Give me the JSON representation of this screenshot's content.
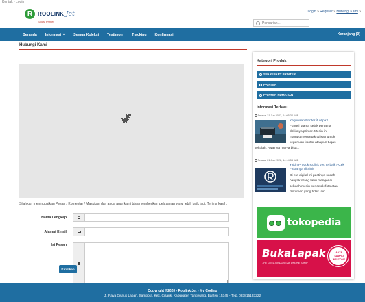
{
  "window": {
    "tab_title": "Kontak - Login"
  },
  "brand": {
    "logo_letter": "R",
    "name": "ROOLINK",
    "name_suffix": "Jet",
    "tagline": "Solusi Printer"
  },
  "top_links": {
    "login": "Login",
    "sep1": "»",
    "register": "Register",
    "sep2": "»",
    "contact": "Hubungi Kami",
    "sep3": "»"
  },
  "search": {
    "placeholder": "Pencarian..."
  },
  "nav": {
    "items": [
      {
        "label": "Beranda"
      },
      {
        "label": "Informasi"
      },
      {
        "label": "Semua Koleksi"
      },
      {
        "label": "Testimoni"
      },
      {
        "label": "Tracking"
      },
      {
        "label": "Konfirmasi"
      }
    ],
    "cart": "Keranjang (0)"
  },
  "main": {
    "title": "Hubungi Kami",
    "notice": "Silahkan meninggalkan Pesan / Komentar / Masukan dari anda agar kami bisa memberikan pelayanan yang lebih baik lagi. Terima kasih.",
    "form": {
      "name_label": "Nama Lengkap",
      "email_label": "Alamat Email",
      "message_label": "Isi Pesan",
      "submit": "Kirimkan"
    }
  },
  "sidebar": {
    "category_title": "Kategori Produk",
    "categories": [
      {
        "label": "SPAREPART PRINTER"
      },
      {
        "label": "PRINTER"
      },
      {
        "label": "PRINTER RUMAHAN"
      }
    ],
    "info_title": "Informasi Terbaru",
    "posts": [
      {
        "date": "Selasa, 21 Jun 2022, 14:05:32 WIB",
        "title": "Kegunaan Printer itu Apa?",
        "lines": [
          "Fungsi utama sejak pertama",
          "dirilisnya printer. Mesin ini",
          "mampu mencetak tulisan untuk",
          "keperluan kantor ataupun tugas"
        ],
        "tail": "sekolah. Awalnya hanya bisa..."
      },
      {
        "date": "Selasa, 21 Jun 2022, 14:14:54 WIB",
        "title": "Yakin Produk Rolink Jet Terbaik? Cek Faktanya di Sini!",
        "lines": [
          "Di era digital ini pastinya sudah",
          "banyak orang tahu mengenai",
          "sebuah mesin pencetak foto atau",
          "dokumen yang tidak lain..."
        ]
      }
    ],
    "banners": {
      "tokopedia": "tokopedia",
      "bukalapak": "BukaLapak",
      "bukalapak_tag": "THE GREAT INDONESIA ONLINE SHOP",
      "bukalapak_bag": [
        "ANTA",
        "SAMPAI",
        "WELCOME"
      ]
    }
  },
  "footer": {
    "line1": "Copyright ©2020 - Roolink Jet - My Coding",
    "line2": "Jl. Raya Cisauk Lapan, Sampora, Kec. Cisauk, Kabupaten Tangerang, Banten 15345 - Telp. 083815133222"
  },
  "colors": {
    "nav": "#1f6ea1",
    "accent": "#c0392b",
    "brand_green": "#2e9c3a",
    "tokopedia": "#3bb54a",
    "bukalapak": "#d71149"
  }
}
